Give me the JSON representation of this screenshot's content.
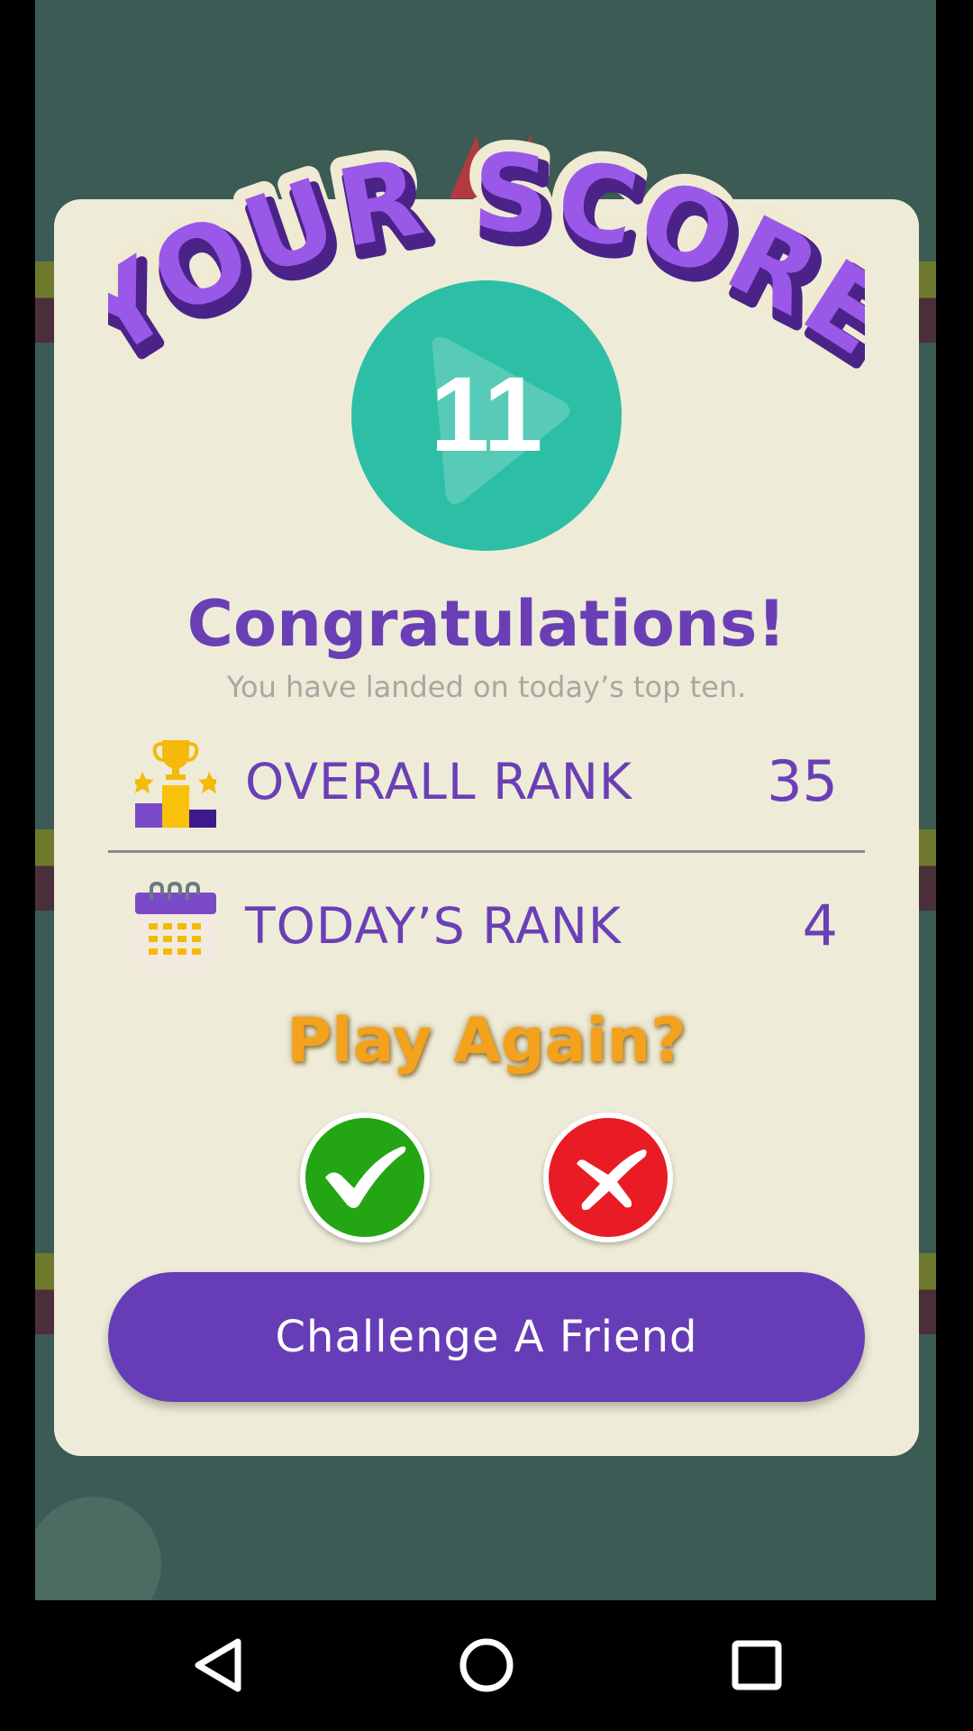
{
  "header": {
    "title": "YOUR SCORE"
  },
  "score": {
    "value": "11"
  },
  "result": {
    "heading": "Congratulations!",
    "message": "You have landed on today’s top ten."
  },
  "ranks": [
    {
      "label": "OVERALL RANK",
      "value": "35",
      "icon": "trophy-podium-icon"
    },
    {
      "label": "TODAY’S RANK",
      "value": "4",
      "icon": "calendar-icon"
    }
  ],
  "play_again": {
    "prompt": "Play Again?",
    "yes_icon": "checkmark-icon",
    "no_icon": "cross-icon"
  },
  "challenge": {
    "label": "Challenge A Friend"
  },
  "nav": {
    "back_icon": "back-triangle-icon",
    "home_icon": "home-circle-icon",
    "recent_icon": "recents-square-icon"
  },
  "colors": {
    "accent_purple": "#673db7",
    "score_teal": "#2dbea6",
    "play_again_orange": "#f4a21b",
    "yes_green": "#24a513",
    "no_red": "#e91b25",
    "card_bg": "#eeecd8"
  }
}
